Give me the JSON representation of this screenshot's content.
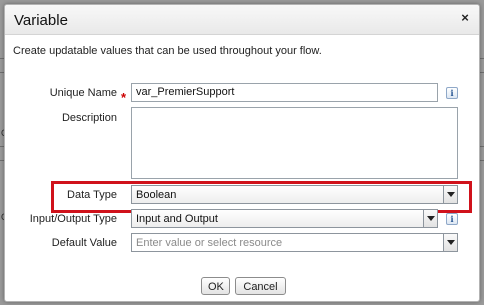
{
  "dialog": {
    "title": "Variable",
    "close_icon": "×",
    "intro": "Create updatable values that can be used throughout your flow."
  },
  "fields": {
    "unique_name": {
      "label": "Unique Name",
      "required_marker": "*",
      "value": "var_PremierSupport"
    },
    "description": {
      "label": "Description",
      "value": ""
    },
    "data_type": {
      "label": "Data Type",
      "value": "Boolean"
    },
    "io_type": {
      "label": "Input/Output Type",
      "value": "Input and Output"
    },
    "default_value": {
      "label": "Default Value",
      "placeholder": "Enter value or select resource"
    }
  },
  "info_icon_glyph": "i",
  "buttons": {
    "ok": "OK",
    "cancel": "Cancel"
  },
  "colors": {
    "highlight": "#d0121b",
    "required": "#cc0000"
  },
  "backdrop_glyphs": [
    "C",
    "C"
  ]
}
